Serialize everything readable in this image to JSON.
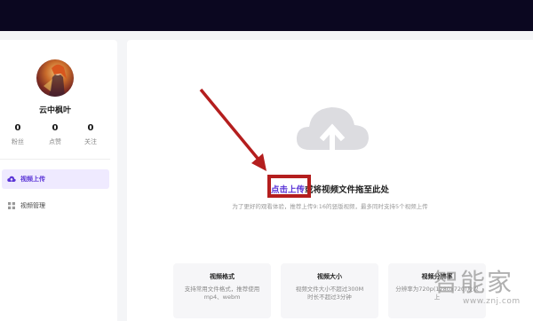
{
  "user": {
    "name": "云中枫叶",
    "stats": [
      {
        "value": "0",
        "label": "粉丝"
      },
      {
        "value": "0",
        "label": "点赞"
      },
      {
        "value": "0",
        "label": "关注"
      }
    ]
  },
  "sidebar": {
    "items": [
      {
        "label": "视频上传",
        "icon": "upload-cloud-icon",
        "active": true
      },
      {
        "label": "视频管理",
        "icon": "grid-icon",
        "active": false
      }
    ]
  },
  "upload": {
    "link_text": "点击上传",
    "rest_text": "或将视频文件拖至此处",
    "hint": "为了更好的观看体验，推荐上传9:16的竖版视频，最多同时支持5个视频上传"
  },
  "cards": [
    {
      "title": "视频格式",
      "lines": [
        "支持常用文件格式，推荐使用",
        "mp4、webm"
      ]
    },
    {
      "title": "视频大小",
      "lines": [
        "视频文件大小不超过300M",
        "时长不超过3分钟"
      ]
    },
    {
      "title": "视频分辨率",
      "lines": [
        "分辨率为720p(1280x720)及以",
        "上"
      ]
    }
  ],
  "watermark": {
    "text": "智能家",
    "url": "www.znj.com"
  },
  "colors": {
    "accent": "#5a34d6",
    "annotation": "#b41e1e",
    "topbar": "#0b0720"
  }
}
